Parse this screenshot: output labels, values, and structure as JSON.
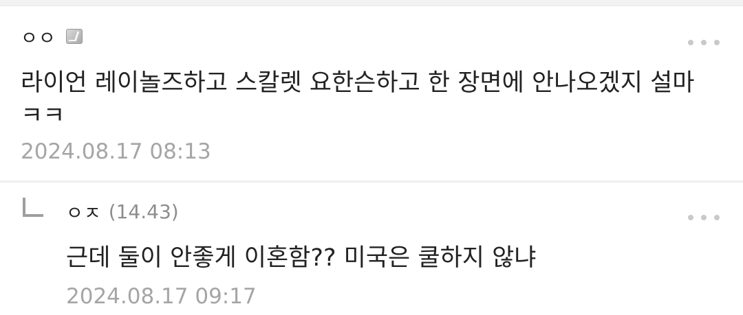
{
  "comments": [
    {
      "author": "ㅇㅇ",
      "badge_icon": "member-badge-icon",
      "body": "라이언 레이놀즈하고 스칼렛 요한슨하고 한 장면에 안나오겠지 설마\nㅋㅋ",
      "timestamp": "2024.08.17 08:13"
    }
  ],
  "replies": [
    {
      "author": "ㅇㅈ",
      "level": "(14.43)",
      "body": "근데 둘이 안좋게 이혼함?? 미국은 쿨하지 않냐",
      "timestamp": "2024.08.17 09:17"
    }
  ],
  "icons": {
    "more": "more-options-icon",
    "reply": "reply-arrow-icon"
  },
  "colors": {
    "text": "#222222",
    "muted": "#a5a5a5",
    "divider": "#efefef"
  }
}
